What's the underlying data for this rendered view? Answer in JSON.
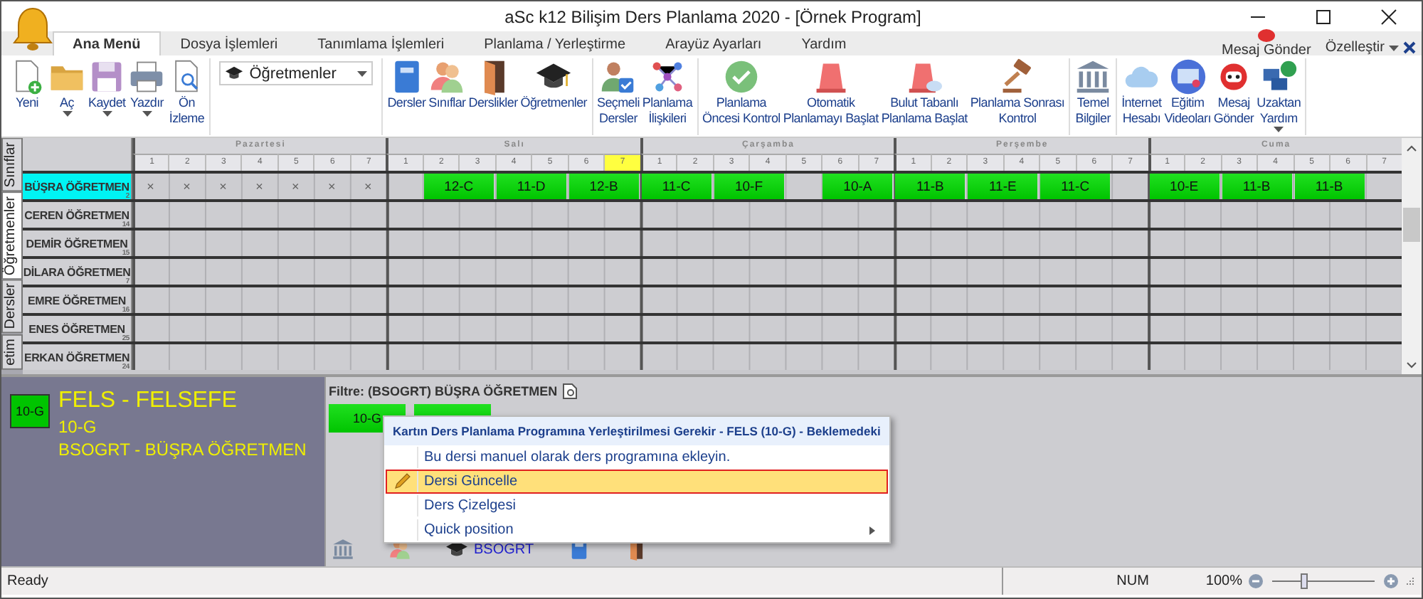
{
  "window": {
    "title": "aSc k12 Bilişim Ders Planlama 2020  - [Örnek Program]"
  },
  "tabs": [
    {
      "label": "Ana Menü",
      "selected": true
    },
    {
      "label": "Dosya İşlemleri",
      "selected": false
    },
    {
      "label": "Tanımlama İşlemleri",
      "selected": false
    },
    {
      "label": "Planlama / Yerleştirme",
      "selected": false
    },
    {
      "label": "Arayüz Ayarları",
      "selected": false
    },
    {
      "label": "Yardım",
      "selected": false
    }
  ],
  "quick_actions": {
    "message": "Mesaj Gönder",
    "customize": "Özelleştir"
  },
  "ribbon": {
    "groups": [
      {
        "kind": "buttons",
        "buttons": [
          {
            "label": "Yeni",
            "dropdown": false
          },
          {
            "label": "Aç",
            "dropdown": true
          },
          {
            "label": "Kaydet",
            "dropdown": true
          },
          {
            "label": "Yazdır",
            "dropdown": true
          },
          {
            "label": "Ön\nİzleme",
            "dropdown": false
          }
        ]
      },
      {
        "kind": "selector",
        "value": "Öğretmenler"
      },
      {
        "kind": "buttons",
        "buttons": [
          {
            "label": "Dersler",
            "dropdown": false
          },
          {
            "label": "Sınıflar",
            "dropdown": false
          },
          {
            "label": "Derslikler",
            "dropdown": false
          },
          {
            "label": "Öğretmenler",
            "dropdown": false
          }
        ]
      },
      {
        "kind": "buttons",
        "buttons": [
          {
            "label": "Seçmeli\nDersler",
            "dropdown": false
          },
          {
            "label": "Planlama\nİlişkileri",
            "dropdown": false
          }
        ]
      },
      {
        "kind": "buttons",
        "buttons": [
          {
            "label": "Planlama\nÖncesi Kontrol",
            "dropdown": false
          },
          {
            "label": "Otomatik\nPlanlamayı Başlat",
            "dropdown": false
          },
          {
            "label": "Bulut Tabanlı\nPlanlama Başlat",
            "dropdown": false
          },
          {
            "label": "Planlama Sonrası\nKontrol",
            "dropdown": false
          }
        ]
      },
      {
        "kind": "buttons",
        "buttons": [
          {
            "label": "Temel\nBilgiler",
            "dropdown": false
          }
        ]
      },
      {
        "kind": "buttons",
        "buttons": [
          {
            "label": "İnternet\nHesabı",
            "dropdown": false
          },
          {
            "label": "Eğitim\nVideoları",
            "dropdown": false
          },
          {
            "label": "Mesaj\nGönder",
            "dropdown": false
          },
          {
            "label": "Uzaktan\nYardım",
            "dropdown": true
          }
        ]
      }
    ]
  },
  "side_tabs": [
    {
      "label": "Sınıflar",
      "selected": false
    },
    {
      "label": "Öğretmenler",
      "selected": true
    },
    {
      "label": "Dersler",
      "selected": false
    },
    {
      "label": "etim",
      "selected": false
    }
  ],
  "timetable": {
    "days": [
      {
        "name": "Pazartesi",
        "periods": [
          {
            "label": "1",
            "selected": false
          },
          {
            "label": "2",
            "selected": false
          },
          {
            "label": "3",
            "selected": false
          },
          {
            "label": "4",
            "selected": false
          },
          {
            "label": "5",
            "selected": false
          },
          {
            "label": "6",
            "selected": false
          },
          {
            "label": "7",
            "selected": false
          }
        ]
      },
      {
        "name": "Salı",
        "periods": [
          {
            "label": "1",
            "selected": false
          },
          {
            "label": "2",
            "selected": false
          },
          {
            "label": "3",
            "selected": false
          },
          {
            "label": "4",
            "selected": false
          },
          {
            "label": "5",
            "selected": false
          },
          {
            "label": "6",
            "selected": false
          },
          {
            "label": "7",
            "selected": true
          }
        ]
      },
      {
        "name": "Çarşamba",
        "periods": [
          {
            "label": "1",
            "selected": false
          },
          {
            "label": "2",
            "selected": false
          },
          {
            "label": "3",
            "selected": false
          },
          {
            "label": "4",
            "selected": false
          },
          {
            "label": "5",
            "selected": false
          },
          {
            "label": "6",
            "selected": false
          },
          {
            "label": "7",
            "selected": false
          }
        ]
      },
      {
        "name": "Perşembe",
        "periods": [
          {
            "label": "1",
            "selected": false
          },
          {
            "label": "2",
            "selected": false
          },
          {
            "label": "3",
            "selected": false
          },
          {
            "label": "4",
            "selected": false
          },
          {
            "label": "5",
            "selected": false
          },
          {
            "label": "6",
            "selected": false
          },
          {
            "label": "7",
            "selected": false
          }
        ]
      },
      {
        "name": "Cuma",
        "periods": [
          {
            "label": "1",
            "selected": false
          },
          {
            "label": "2",
            "selected": false
          },
          {
            "label": "3",
            "selected": false
          },
          {
            "label": "4",
            "selected": false
          },
          {
            "label": "5",
            "selected": false
          },
          {
            "label": "6",
            "selected": false
          },
          {
            "label": "7",
            "selected": false
          }
        ]
      }
    ],
    "rows": [
      {
        "name": "BÜŞRA ÖĞRETMEN",
        "count": "2",
        "selected": true,
        "cells": [
          {
            "kind": "blocked",
            "text": "×"
          },
          {
            "kind": "blocked",
            "text": "×"
          },
          {
            "kind": "blocked",
            "text": "×"
          },
          {
            "kind": "blocked",
            "text": "×"
          },
          {
            "kind": "blocked",
            "text": "×"
          },
          {
            "kind": "blocked",
            "text": "×"
          },
          {
            "kind": "blocked",
            "text": "×"
          },
          {
            "kind": "empty"
          },
          {
            "kind": "lesson",
            "text": "12-C"
          },
          {
            "kind": "continued"
          },
          {
            "kind": "lesson",
            "text": "11-D"
          },
          {
            "kind": "continued"
          },
          {
            "kind": "lesson",
            "text": "12-B"
          },
          {
            "kind": "continued"
          },
          {
            "kind": "lesson",
            "text": "11-C"
          },
          {
            "kind": "continued"
          },
          {
            "kind": "lesson",
            "text": "10-F"
          },
          {
            "kind": "continued"
          },
          {
            "kind": "empty"
          },
          {
            "kind": "lesson",
            "text": "10-A"
          },
          {
            "kind": "continued"
          },
          {
            "kind": "lesson",
            "text": "11-B"
          },
          {
            "kind": "continued"
          },
          {
            "kind": "lesson",
            "text": "11-E"
          },
          {
            "kind": "continued"
          },
          {
            "kind": "lesson",
            "text": "11-C"
          },
          {
            "kind": "continued"
          },
          {
            "kind": "empty"
          },
          {
            "kind": "lesson",
            "text": "10-E"
          },
          {
            "kind": "continued"
          },
          {
            "kind": "lesson",
            "text": "11-B"
          },
          {
            "kind": "continued"
          },
          {
            "kind": "lesson",
            "text": "11-B"
          },
          {
            "kind": "continued"
          },
          {
            "kind": "empty"
          }
        ]
      },
      {
        "name": "CEREN ÖĞRETMEN",
        "count": "14",
        "selected": false
      },
      {
        "name": "DEMİR ÖĞRETMEN",
        "count": "15",
        "selected": false
      },
      {
        "name": "DİLARA ÖĞRETMEN",
        "count": "7",
        "selected": false
      },
      {
        "name": "EMRE ÖĞRETMEN",
        "count": "16",
        "selected": false
      },
      {
        "name": "ENES ÖĞRETMEN",
        "count": "25",
        "selected": false
      },
      {
        "name": "ERKAN ÖĞRETMEN",
        "count": "24",
        "selected": false
      }
    ]
  },
  "lesson_card": {
    "badge": "10-G",
    "title": "FELS - FELSEFE",
    "class": "10-G",
    "teacher": "BSOGRT - BÜŞRA ÖĞRETMEN"
  },
  "filter": {
    "text": "Filtre: (BSOGRT) BÜŞRA ÖĞRETMEN"
  },
  "cards": [
    {
      "kind": "labeled",
      "label": "10-G"
    },
    {
      "kind": "covered"
    }
  ],
  "context_menu": {
    "header": "Kartın Ders Planlama Programına Yerleştirilmesi Gerekir - FELS (10-G) - Beklemedeki",
    "items": [
      {
        "kind": "plain",
        "label": "Bu dersi manuel olarak ders programına ekleyin.",
        "selected": false
      },
      {
        "kind": "edit",
        "label": "Dersi Güncelle",
        "selected": true
      },
      {
        "kind": "plain",
        "label": "Ders Çizelgesi",
        "selected": false
      },
      {
        "kind": "submenu",
        "label": "Quick position",
        "selected": false
      }
    ]
  },
  "detail_links": {
    "teacher_code": "BSOGRT"
  },
  "status_bar": {
    "status": "Ready",
    "num": "NUM",
    "zoom": "100%",
    "zoom_slider": {
      "level": 0.3
    }
  }
}
